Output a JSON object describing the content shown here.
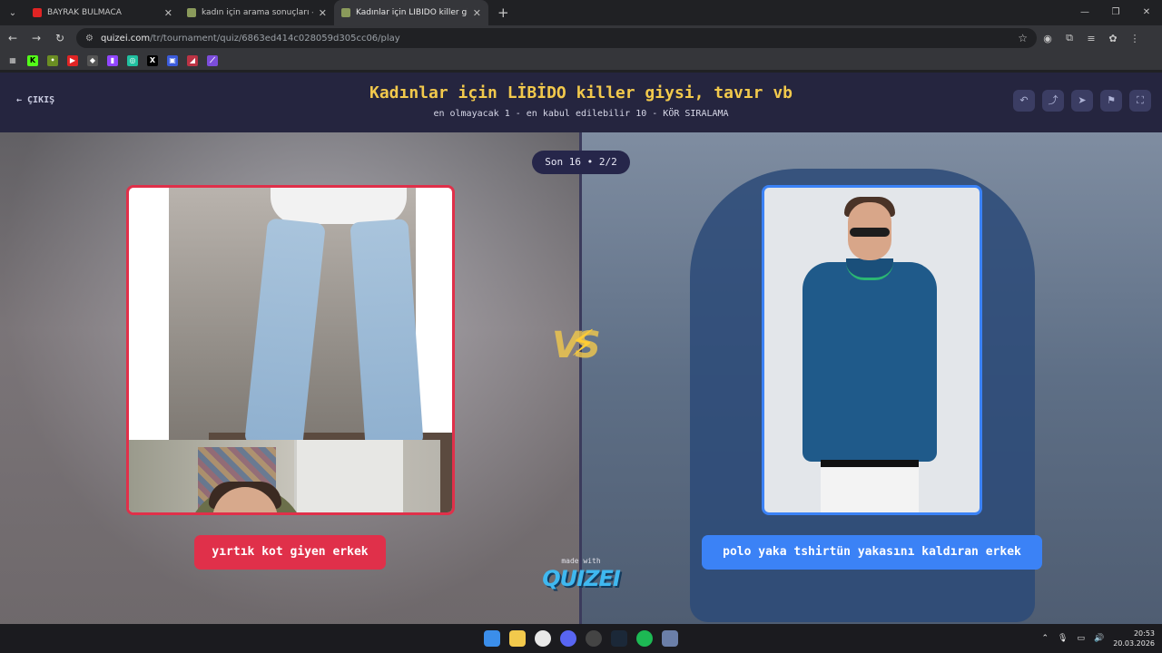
{
  "browser": {
    "tabs": [
      {
        "title": "BAYRAK BULMACA",
        "active": false,
        "fav_color": "#e02424"
      },
      {
        "title": "kadın için arama sonuçları - Qu",
        "active": false,
        "fav_color": "#8a9a5b"
      },
      {
        "title": "Kadınlar için LİBİDO killer giysi,",
        "active": true,
        "fav_color": "#8a9a5b"
      }
    ],
    "new_tab": "+",
    "url_domain": "quizei.com",
    "url_path": "/tr/tournament/quiz/6863ed414c028059d305cc06/play"
  },
  "header": {
    "exit_label": "ÇIKIŞ",
    "title": "Kadınlar için LİBİDO killer giysi, tavır vb",
    "subtitle": "en olmayacak 1 - en kabul edilebilir 10 - KÖR SIRALAMA"
  },
  "round": {
    "label": "Son 16 • 2/2"
  },
  "choices": {
    "left": {
      "label": "yırtık kot giyen erkek",
      "color": "#e0304a"
    },
    "right": {
      "label": "polo yaka tshirtün yakasını kaldıran erkek",
      "color": "#3b82f6"
    }
  },
  "vs_text": "VS",
  "footer": {
    "made_with": "made with",
    "logo": "QUIZEI"
  },
  "taskbar": {
    "time": "20:53",
    "date": "20.03.2026"
  }
}
